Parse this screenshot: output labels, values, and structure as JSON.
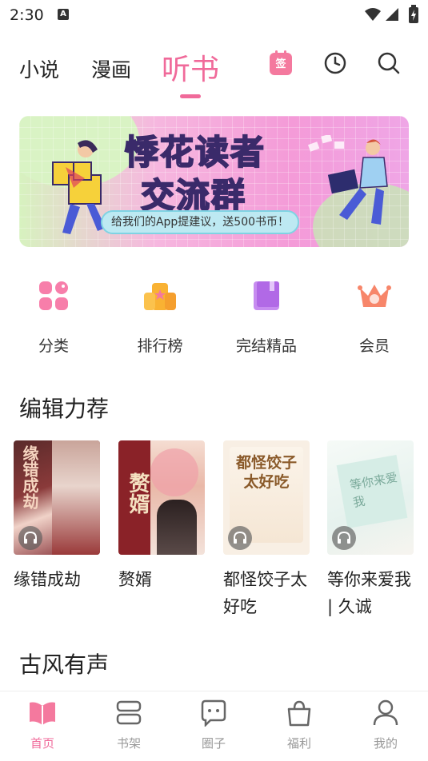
{
  "status_bar": {
    "time": "2:30",
    "notification_icon": "A"
  },
  "top_nav": {
    "tabs": [
      {
        "label": "小说",
        "active": false
      },
      {
        "label": "漫画",
        "active": false
      },
      {
        "label": "听书",
        "active": true
      }
    ],
    "sign_in_label": "签",
    "icons": [
      "sign-in-icon",
      "history-clock-icon",
      "search-icon"
    ]
  },
  "banner": {
    "title_line1": "悸花读者",
    "title_line2": "交流群",
    "pill_text": "给我们的App提建议，送500书币！"
  },
  "quick_menu": [
    {
      "label": "分类",
      "icon": "category-grid-icon"
    },
    {
      "label": "排行榜",
      "icon": "ranking-podium-icon"
    },
    {
      "label": "完结精品",
      "icon": "completed-book-icon"
    },
    {
      "label": "会员",
      "icon": "vip-crown-icon"
    }
  ],
  "sections": {
    "editor_pick": "编辑力荐",
    "ancient_audio": "古风有声"
  },
  "books": [
    {
      "title": "缘错成劫",
      "cover_text": "缘错成劫"
    },
    {
      "title": "赘婿",
      "cover_text": "赘婿"
    },
    {
      "title": "都怪饺子太好吃",
      "cover_text": "都怪饺子太好吃"
    },
    {
      "title": "等你来爱我 | 久诚",
      "cover_text": "等你来爱我"
    }
  ],
  "bottom_nav": [
    {
      "label": "首页",
      "active": true,
      "icon": "home-book-icon"
    },
    {
      "label": "书架",
      "active": false,
      "icon": "bookshelf-icon"
    },
    {
      "label": "圈子",
      "active": false,
      "icon": "chat-bubble-icon"
    },
    {
      "label": "福利",
      "active": false,
      "icon": "gift-bag-icon"
    },
    {
      "label": "我的",
      "active": false,
      "icon": "profile-icon"
    }
  ],
  "colors": {
    "accent": "#f06a9a",
    "text": "#222222",
    "muted": "#999999"
  }
}
